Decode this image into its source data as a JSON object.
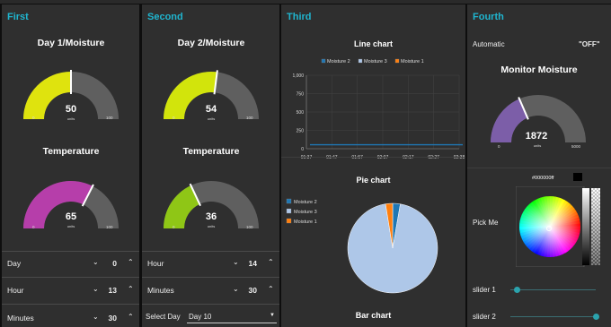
{
  "colors": {
    "accent": "#1fb5cf",
    "panel": "#2f2f2f",
    "track": "#5f5f5f"
  },
  "groups": [
    "First",
    "Second",
    "Third",
    "Fourth"
  ],
  "first": {
    "gauge1": {
      "title": "Day 1/Moisture",
      "value": "50",
      "unit": "units",
      "min": "0",
      "max": "100",
      "fraction": 0.5,
      "color": "#dfe30e"
    },
    "gauge2": {
      "title": "Temperature",
      "value": "65",
      "unit": "units",
      "min": "0",
      "max": "100",
      "fraction": 0.65,
      "color": "#b63eaa"
    },
    "rows": [
      {
        "label": "Day",
        "value": "0"
      },
      {
        "label": "Hour",
        "value": "13"
      },
      {
        "label": "Minutes",
        "value": "30"
      }
    ]
  },
  "second": {
    "gauge1": {
      "title": "Day 2/Moisture",
      "value": "54",
      "unit": "units",
      "min": "0",
      "max": "100",
      "fraction": 0.54,
      "color": "#d2e40c"
    },
    "gauge2": {
      "title": "Temperature",
      "value": "36",
      "unit": "units",
      "min": "0",
      "max": "100",
      "fraction": 0.36,
      "color": "#8fc616"
    },
    "rows": [
      {
        "label": "Hour",
        "value": "14"
      },
      {
        "label": "Minutes",
        "value": "30"
      }
    ],
    "select_label": "Select Day",
    "select_value": "Day 10"
  },
  "third": {
    "line_title": "Line chart",
    "pie_title": "Pie chart",
    "bar_title": "Bar chart"
  },
  "fourth": {
    "auto_label": "Automatic",
    "auto_value": "\"OFF\"",
    "gauge": {
      "title": "Monitor Moisture",
      "value": "1872",
      "unit": "units",
      "min": "0",
      "max": "5000",
      "fraction": 0.37,
      "color": "#7c5ea8"
    },
    "picker_label": "Pick Me",
    "picker_value": "#000000ff",
    "slider1_label": "slider 1",
    "slider1_value": 0.08,
    "slider2_label": "slider 2",
    "slider2_value": 1.0
  },
  "chart_data": [
    {
      "type": "line",
      "title": "Line chart",
      "legend": [
        "Moisture 2",
        "Moisture 3",
        "Moisture 1"
      ],
      "colors": [
        "#1f77b4",
        "#aec7e8",
        "#ff7f0e"
      ],
      "x": [
        "01:37",
        "01:47",
        "01:57",
        "02:07",
        "02:17",
        "02:27",
        "02:38"
      ],
      "yticks": [
        "0",
        "250",
        "500",
        "750",
        "1,000"
      ],
      "ylim": [
        0,
        1000
      ],
      "series": [
        {
          "name": "Moisture 2",
          "values": [
            54,
            54,
            54,
            54,
            54,
            54,
            54
          ]
        }
      ]
    },
    {
      "type": "pie",
      "title": "Pie chart",
      "legend": [
        "Moisture 2",
        "Moisture 3",
        "Moisture 1"
      ],
      "colors": [
        "#1f77b4",
        "#aec7e8",
        "#ff7f0e"
      ],
      "values": [
        54,
        1872,
        50
      ]
    }
  ]
}
